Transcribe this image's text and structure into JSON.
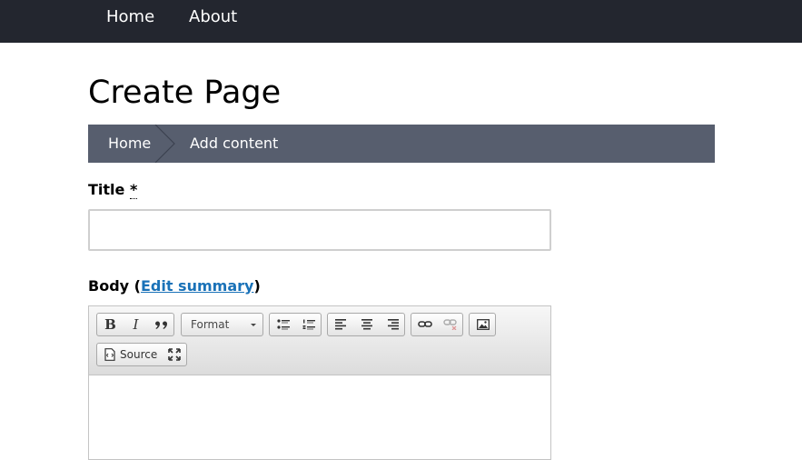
{
  "nav": {
    "items": [
      {
        "label": "Home"
      },
      {
        "label": "About"
      }
    ]
  },
  "page": {
    "title": "Create Page"
  },
  "breadcrumb": {
    "items": [
      {
        "label": "Home"
      },
      {
        "label": "Add content"
      }
    ]
  },
  "form": {
    "title_field": {
      "label": "Title",
      "required_marker": "*",
      "value": ""
    },
    "body_field": {
      "label": "Body",
      "open_paren": "(",
      "edit_summary_link": "Edit summary",
      "close_paren": ")"
    }
  },
  "editor": {
    "toolbar": {
      "bold": "B",
      "italic": "I",
      "format_label": "Format",
      "source_label": "Source"
    }
  },
  "colors": {
    "topbar": "#23262f",
    "breadcrumb": "#575e6e",
    "link": "#1a72b8"
  }
}
